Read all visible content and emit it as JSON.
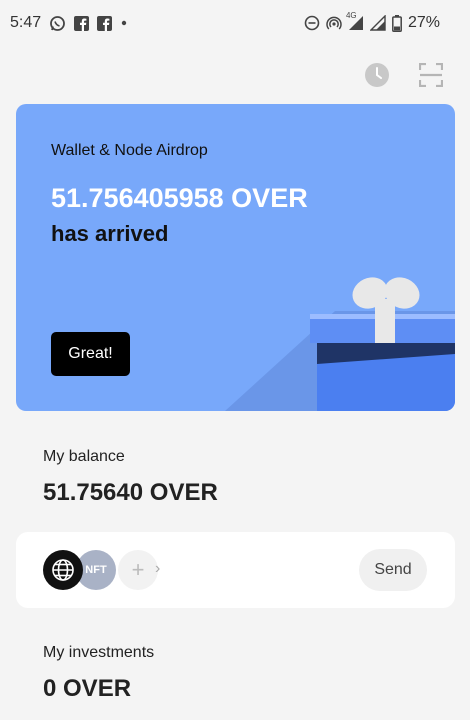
{
  "status_bar": {
    "time": "5:47",
    "network": "4G",
    "battery": "27%"
  },
  "airdrop": {
    "title": "Wallet & Node Airdrop",
    "amount": "51.756405958 OVER",
    "subtitle": "has arrived",
    "button_label": "Great!"
  },
  "balance": {
    "label": "My balance",
    "value": "51.75640 OVER"
  },
  "assets": {
    "chevron": "›",
    "add_symbol": "+",
    "nft_label": "NFT",
    "send_label": "Send"
  },
  "investments": {
    "label": "My investments",
    "value": "0 OVER"
  },
  "colors": {
    "card_bg": "#78a8fa",
    "gift_blue": "#4b7ff0",
    "button_black": "#000000"
  }
}
